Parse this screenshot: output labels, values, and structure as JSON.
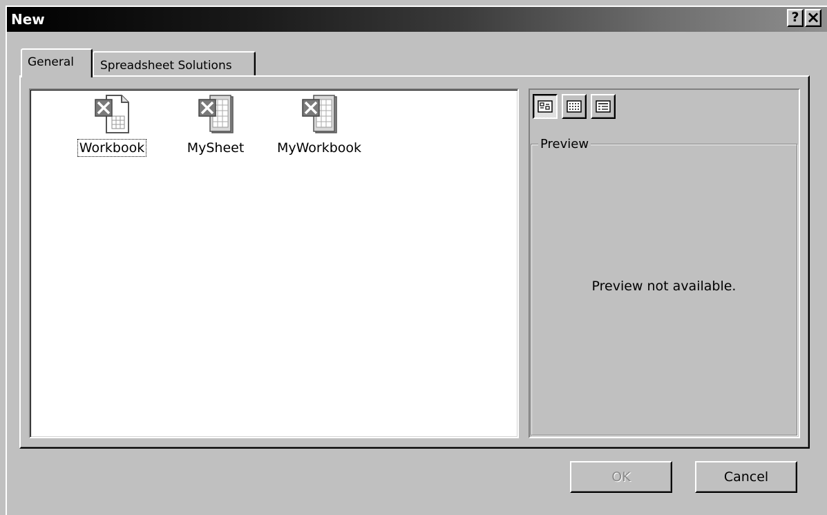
{
  "window": {
    "title": "New",
    "help_button": "?",
    "close_button": "×"
  },
  "tabs": [
    {
      "label": "General",
      "selected": true
    },
    {
      "label": "Spreadsheet Solutions",
      "selected": false
    }
  ],
  "templates": [
    {
      "label": "Workbook",
      "icon": "excel-workbook-template-icon",
      "focused": true
    },
    {
      "label": "MySheet",
      "icon": "excel-template-icon",
      "focused": false
    },
    {
      "label": "MyWorkbook",
      "icon": "excel-template-icon",
      "focused": false
    }
  ],
  "view_buttons": [
    {
      "icon": "large-icons-view-icon",
      "pressed": true
    },
    {
      "icon": "list-view-icon",
      "pressed": false
    },
    {
      "icon": "details-view-icon",
      "pressed": false
    }
  ],
  "preview": {
    "group_label": "Preview",
    "message": "Preview not available."
  },
  "buttons": {
    "ok_label": "OK",
    "ok_enabled": false,
    "cancel_label": "Cancel"
  }
}
